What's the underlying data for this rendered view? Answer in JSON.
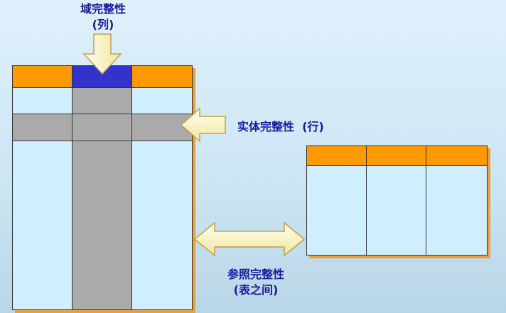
{
  "labels": {
    "domain_integrity": "域完整性",
    "domain_note": "(列)",
    "entity_integrity": "实体完整性  (行)",
    "referential_integrity": "参照完整性",
    "referential_note": "(表之间)"
  },
  "colors": {
    "header": "#ff9900",
    "highlight_column_header": "#3333cc",
    "highlight": "#aaaaaa",
    "cell": "#cfeeff",
    "arrow": "#ffffcc",
    "label_text": "#1a1aa0"
  }
}
